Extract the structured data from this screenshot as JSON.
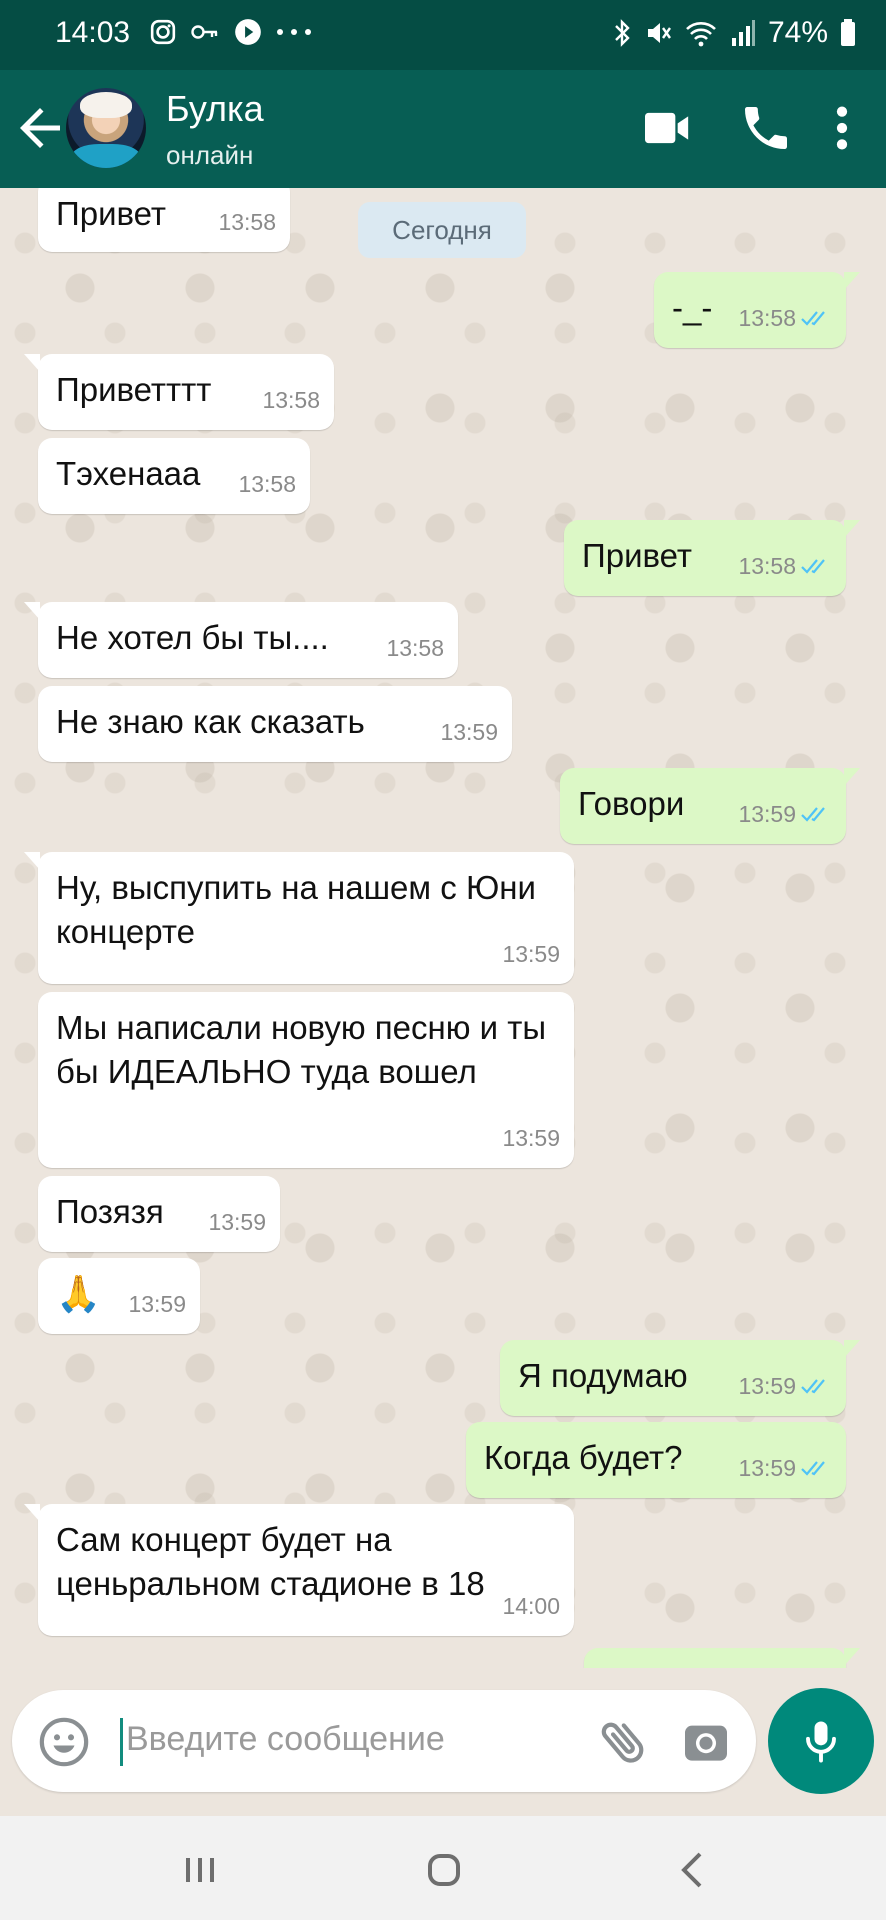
{
  "status_bar": {
    "time": "14:03",
    "battery": "74%"
  },
  "header": {
    "contact_name": "Булка",
    "status": "онлайн"
  },
  "date_chip": "Сегодня",
  "messages": [
    {
      "dir": "in",
      "text": "Привет",
      "time": "13:58"
    },
    {
      "dir": "out",
      "text": "-_-",
      "time": "13:58",
      "read": true
    },
    {
      "dir": "in",
      "text": "Приветттт",
      "time": "13:58"
    },
    {
      "dir": "in",
      "text": "Тэхенааа",
      "time": "13:58"
    },
    {
      "dir": "out",
      "text": "Привет",
      "time": "13:58",
      "read": true
    },
    {
      "dir": "in",
      "text": "Не хотел бы ты....",
      "time": "13:58"
    },
    {
      "dir": "in",
      "text": "Не знаю как сказать",
      "time": "13:59"
    },
    {
      "dir": "out",
      "text": "Говори",
      "time": "13:59",
      "read": true
    },
    {
      "dir": "in",
      "text": "Ну, выспупить на нашем с Юни концерте",
      "time": "13:59"
    },
    {
      "dir": "in",
      "text": "Мы написали новую песню и ты бы ИДЕАЛЬНО туда вошел",
      "time": "13:59"
    },
    {
      "dir": "in",
      "text": "Позязя",
      "time": "13:59"
    },
    {
      "dir": "in",
      "text": "🙏",
      "time": "13:59"
    },
    {
      "dir": "out",
      "text": "Я подумаю",
      "time": "13:59",
      "read": true
    },
    {
      "dir": "out",
      "text": "Когда будет?",
      "time": "13:59",
      "read": true
    },
    {
      "dir": "in",
      "text": "Сам концерт будет на ценьральном стадионе в 18",
      "time": "14:00"
    }
  ],
  "input": {
    "placeholder": "Введите сообщение"
  },
  "colors": {
    "header": "#075e54",
    "status_bar": "#054d44",
    "outgoing": "#dcf8c6",
    "accent": "#00897b",
    "read_ticks": "#4fc3f7"
  },
  "icons": [
    "back-arrow-icon",
    "video-call-icon",
    "voice-call-icon",
    "more-vert-icon",
    "emoji-icon",
    "attach-icon",
    "camera-icon",
    "mic-icon"
  ]
}
